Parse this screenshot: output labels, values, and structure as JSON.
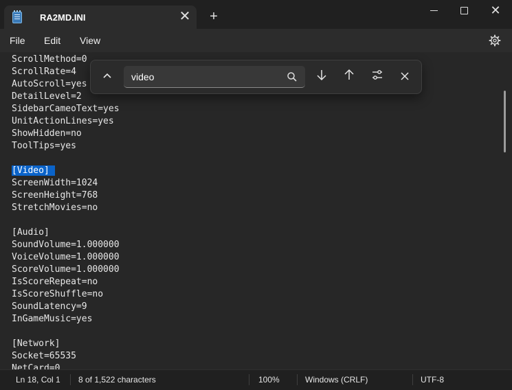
{
  "window": {
    "tab_title": "RA2MD.INI",
    "tab_close": "✕",
    "new_tab": "+",
    "close": "✕"
  },
  "menu": {
    "file": "File",
    "edit": "Edit",
    "view": "View"
  },
  "icons": {
    "app": "notepad-icon",
    "settings": "gear-icon",
    "search": "search-icon"
  },
  "find": {
    "query": "video",
    "collapse": "⌃",
    "next": "↓",
    "prev": "↑",
    "close": "✕"
  },
  "editor": {
    "lines": [
      "ScrollMethod=0",
      "ScrollRate=4",
      "AutoScroll=yes",
      "DetailLevel=2",
      "SidebarCameoText=yes",
      "UnitActionLines=yes",
      "ShowHidden=no",
      "ToolTips=yes",
      "",
      "[Video]",
      "ScreenWidth=1024",
      "ScreenHeight=768",
      "StretchMovies=no",
      "",
      "[Audio]",
      "SoundVolume=1.000000",
      "VoiceVolume=1.000000",
      "ScoreVolume=1.000000",
      "IsScoreRepeat=no",
      "IsScoreShuffle=no",
      "SoundLatency=9",
      "InGameMusic=yes",
      "",
      "[Network]",
      "Socket=65535",
      "NetCard=0"
    ],
    "highlighted_line": 9
  },
  "status": {
    "position": "Ln 18, Col 1",
    "chars": "8 of 1,522 characters",
    "zoom": "100%",
    "line_ending": "Windows (CRLF)",
    "encoding": "UTF-8"
  },
  "colors": {
    "background": "#272727",
    "selection": "#0a63c9"
  }
}
